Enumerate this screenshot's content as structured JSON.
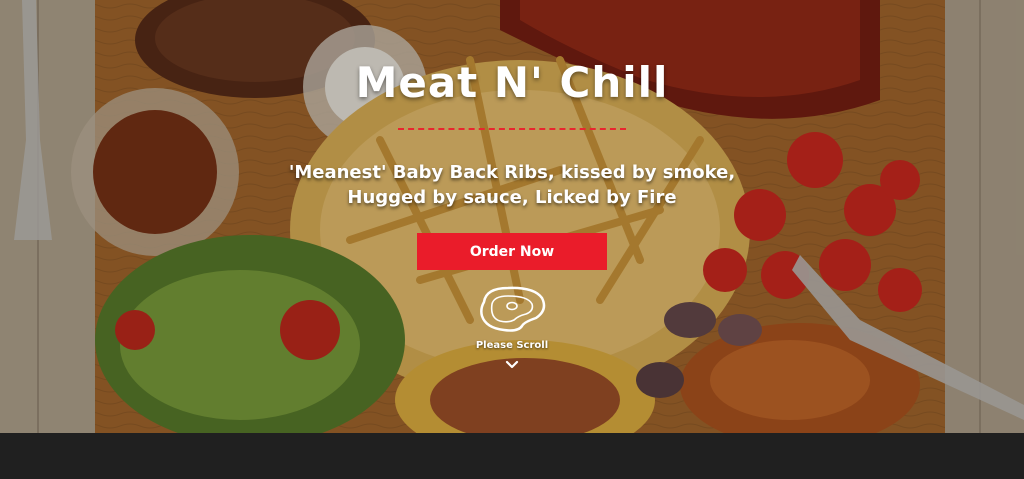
{
  "hero": {
    "title": "Meat N' Chill",
    "tagline_line1": "'Meanest' Baby Back Ribs, kissed by smoke,",
    "tagline_line2": "Hugged by sauce, Licked by Fire",
    "cta_label": "Order Now",
    "scroll_label": "Please Scroll"
  },
  "icons": {
    "steak": "steak-icon",
    "scroll": "chevron-down-icon"
  },
  "colors": {
    "accent": "#ea1c2a",
    "divider": "#e8262f",
    "text": "#ffffff",
    "footer": "#202020"
  }
}
